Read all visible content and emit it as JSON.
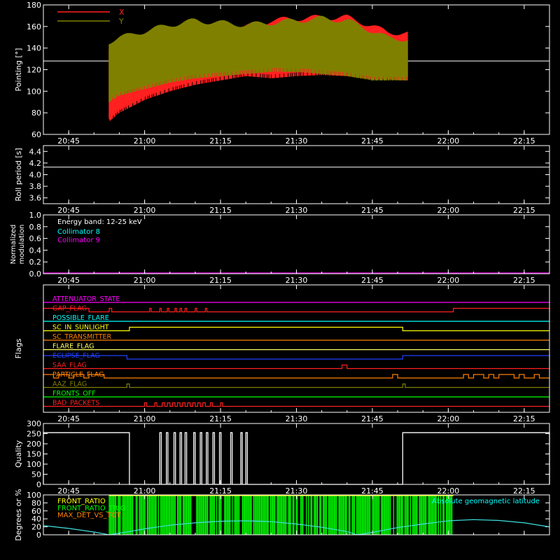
{
  "time_ticks": [
    "20:45",
    "21:00",
    "21:15",
    "21:30",
    "21:45",
    "22:00",
    "22:15"
  ],
  "chart_data": [
    {
      "type": "line",
      "ylabel": "Pointing [°]",
      "ylim": [
        60,
        180
      ],
      "yticks": [
        60,
        80,
        100,
        120,
        140,
        160,
        180
      ],
      "x_range": [
        "20:40",
        "22:20"
      ],
      "data_start": "20:53",
      "data_end": "21:52",
      "reference_line": 128,
      "legend": [
        "X",
        "Y"
      ],
      "series": [
        {
          "name": "X",
          "color": "#ff2020",
          "envelope_x": [
            "20:53",
            "20:55",
            "21:00",
            "21:05",
            "21:10",
            "21:15",
            "21:20",
            "21:25",
            "21:30",
            "21:35",
            "21:40",
            "21:45",
            "21:48",
            "21:52"
          ],
          "upper": [
            142,
            150,
            152,
            154,
            156,
            158,
            162,
            168,
            170,
            171,
            171,
            163,
            157,
            156
          ],
          "lower": [
            72,
            80,
            92,
            100,
            106,
            110,
            114,
            112,
            114,
            115,
            114,
            111,
            111,
            110
          ]
        },
        {
          "name": "Y",
          "color": "#808000",
          "envelope_x": [
            "20:53",
            "20:55",
            "21:00",
            "21:05",
            "21:10",
            "21:15",
            "21:20",
            "21:25",
            "21:30",
            "21:35",
            "21:40",
            "21:45",
            "21:48",
            "21:52"
          ],
          "upper": [
            148,
            152,
            158,
            164,
            168,
            166,
            164,
            166,
            168,
            170,
            168,
            158,
            152,
            150
          ],
          "lower": [
            90,
            96,
            102,
            108,
            112,
            114,
            116,
            118,
            118,
            116,
            114,
            110,
            110,
            110
          ]
        }
      ]
    },
    {
      "type": "line",
      "ylabel": "Roll period [s]",
      "ylim": [
        3.5,
        4.5
      ],
      "yticks": [
        3.6,
        3.8,
        4.0,
        4.2,
        4.4
      ],
      "series": [
        {
          "name": "roll",
          "color": "#ffffff",
          "constant": 4.13
        }
      ]
    },
    {
      "type": "line",
      "ylabel": "Normalized modulation",
      "ylim": [
        0,
        1
      ],
      "yticks": [
        0.0,
        0.2,
        0.4,
        0.6,
        0.8,
        1.0
      ],
      "annotation": "Energy band: 12-25 keV",
      "legend": [
        {
          "name": "Collimator 8",
          "color": "#00ffff"
        },
        {
          "name": "Collimator 9",
          "color": "#ff00ff"
        }
      ],
      "series": [
        {
          "name": "Collimator 9",
          "color": "#cc00cc",
          "constant": 0.0
        }
      ]
    },
    {
      "type": "line",
      "ylabel": "Flags",
      "flags": [
        {
          "name": "ATTENUATOR_STATE",
          "color": "#ff00ff",
          "segments": []
        },
        {
          "name": "GAP_FLAG",
          "color": "#ff2020",
          "segments": [
            [
              "20:40",
              "20:49"
            ],
            [
              "20:53",
              "20:53.5"
            ],
            [
              "21:01",
              "21:01.3"
            ],
            [
              "21:03",
              "21:03.3"
            ],
            [
              "21:04.5",
              "21:04.8"
            ],
            [
              "21:06",
              "21:06.3"
            ],
            [
              "21:07",
              "21:07.3"
            ],
            [
              "21:08",
              "21:08.3"
            ],
            [
              "21:10",
              "21:10.3"
            ],
            [
              "21:12",
              "21:12.3"
            ],
            [
              "22:01",
              "22:20"
            ]
          ]
        },
        {
          "name": "POSSIBLE_FLARE",
          "color": "#00ffff",
          "segments": []
        },
        {
          "name": "SC_IN_SUNLIGHT",
          "color": "#ffff00",
          "segments": [
            [
              "20:57",
              "21:51"
            ]
          ]
        },
        {
          "name": "SC_TRANSMITTER",
          "color": "#ff8000",
          "segments": []
        },
        {
          "name": "FLARE_FLAG",
          "color": "#ffff60",
          "segments": []
        },
        {
          "name": "ECLIPSE_FLAG",
          "color": "#2040ff",
          "segments": [
            [
              "20:40",
              "20:56.5"
            ],
            [
              "21:51",
              "22:20"
            ]
          ]
        },
        {
          "name": "SAA_FLAG",
          "color": "#ff2020",
          "segments": [
            [
              "21:39",
              "21:40"
            ]
          ]
        },
        {
          "name": "PARTICLE_FLAG",
          "color": "#ff8000",
          "segments": [
            [
              "20:40",
              "20:42"
            ],
            [
              "20:43",
              "20:45"
            ],
            [
              "20:46",
              "20:48"
            ],
            [
              "20:49",
              "20:52"
            ],
            [
              "21:49",
              "21:50"
            ],
            [
              "22:03",
              "22:04"
            ],
            [
              "22:05",
              "22:07"
            ],
            [
              "22:08",
              "22:09"
            ],
            [
              "22:10",
              "22:13"
            ],
            [
              "22:14",
              "22:15"
            ],
            [
              "22:17",
              "22:18"
            ]
          ]
        },
        {
          "name": "AAZ_FLAG",
          "color": "#808000",
          "segments": [
            [
              "20:56.5",
              "20:57"
            ],
            [
              "21:51",
              "21:51.5"
            ]
          ]
        },
        {
          "name": "FRONTS_OFF",
          "color": "#00ff00",
          "segments": []
        },
        {
          "name": "BAD_PACKETS",
          "color": "#ff2020",
          "segments": [
            [
              "21:00",
              "21:00.4"
            ],
            [
              "21:02",
              "21:02.4"
            ],
            [
              "21:03.5",
              "21:04"
            ],
            [
              "21:04.5",
              "21:05"
            ],
            [
              "21:05.5",
              "21:06"
            ],
            [
              "21:06.5",
              "21:07"
            ],
            [
              "21:07.5",
              "21:08"
            ],
            [
              "21:08.5",
              "21:09"
            ],
            [
              "21:09.5",
              "21:10"
            ],
            [
              "21:10.5",
              "21:11"
            ],
            [
              "21:11.5",
              "21:12"
            ],
            [
              "21:13",
              "21:13.4"
            ],
            [
              "21:15",
              "21:15.4"
            ]
          ]
        }
      ]
    },
    {
      "type": "line",
      "ylabel": "Quality",
      "ylim": [
        0,
        300
      ],
      "yticks": [
        0,
        50,
        100,
        150,
        200,
        250,
        300
      ],
      "series": [
        {
          "name": "quality",
          "color": "#ffffff",
          "high_value": 255,
          "high_intervals": [
            [
              "20:40",
              "20:57"
            ],
            [
              "21:03",
              "21:03.3"
            ],
            [
              "21:04.3",
              "21:04.6"
            ],
            [
              "21:05.8",
              "21:06.1"
            ],
            [
              "21:07",
              "21:07.3"
            ],
            [
              "21:08",
              "21:08.3"
            ],
            [
              "21:09.7",
              "21:10"
            ],
            [
              "21:11",
              "21:11.3"
            ],
            [
              "21:12.2",
              "21:12.5"
            ],
            [
              "21:13.5",
              "21:13.8"
            ],
            [
              "21:14.8",
              "21:15.1"
            ],
            [
              "21:17",
              "21:17.3"
            ],
            [
              "21:19",
              "21:19.3"
            ],
            [
              "21:20",
              "21:20.3"
            ],
            [
              "21:51",
              "22:20"
            ]
          ]
        }
      ]
    },
    {
      "type": "line",
      "ylabel": "Degrees or %",
      "ylim": [
        0,
        100
      ],
      "yticks": [
        0,
        20,
        40,
        60,
        80,
        100
      ],
      "legend": [
        {
          "name": "FRONT_RATIO",
          "color": "#ffff00"
        },
        {
          "name": "FRONT_RATIO_TRIG",
          "color": "#00ff00"
        },
        {
          "name": "MAX_DET_VS_TOT",
          "color": "#ff8000"
        },
        {
          "name": "Absolute geomagnetic latitude",
          "color": "#00ffff"
        }
      ],
      "band": {
        "name": "FRONT_RATIO_TRIG",
        "color": "#00ff00",
        "from": "20:53",
        "to": "22:01",
        "level": 100
      },
      "series": [
        {
          "name": "Absolute geomagnetic latitude",
          "color": "#40e0e0",
          "x": [
            "20:40",
            "20:45",
            "20:50",
            "20:53",
            "20:57",
            "21:00",
            "21:05",
            "21:10",
            "21:15",
            "21:20",
            "21:25",
            "21:30",
            "21:35",
            "21:40",
            "21:42",
            "21:45",
            "21:50",
            "21:55",
            "22:00",
            "22:05",
            "22:10",
            "22:15",
            "22:20"
          ],
          "y": [
            23,
            16,
            7,
            0,
            8,
            15,
            24,
            30,
            34,
            35,
            33,
            27,
            19,
            8,
            0,
            6,
            18,
            27,
            35,
            38,
            36,
            30,
            20
          ]
        }
      ]
    }
  ]
}
